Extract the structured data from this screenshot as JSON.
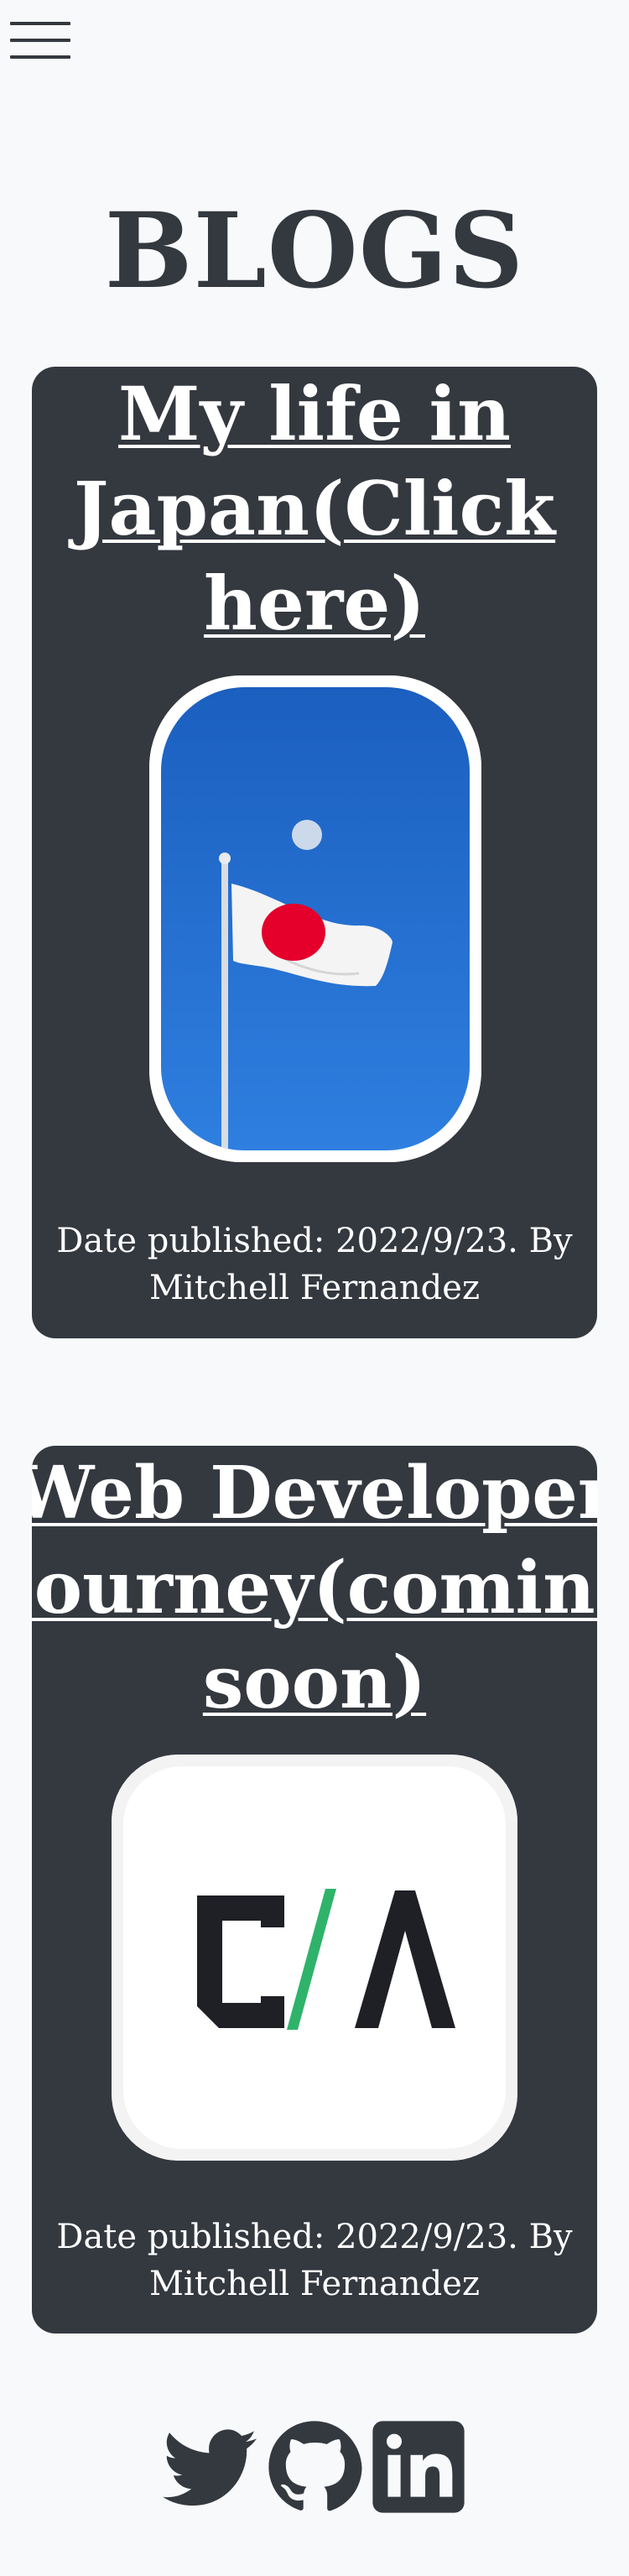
{
  "nav": {
    "menu_icon": "hamburger-menu-icon"
  },
  "page": {
    "title": "BLOGS"
  },
  "blogs": [
    {
      "title_line1": "My life in",
      "title_line2": "Japan(Click",
      "title_line3": "here)",
      "image_alt": "Japanese flag on a flagpole against blue sky with the moon",
      "published_line1": "Date published: 2022/9/23. By",
      "published_line2": "Mitchell Fernandez"
    },
    {
      "title_line1": "Web Developer",
      "title_line2": "Journey(coming",
      "title_line3": "soon)",
      "image_alt": "C/A logo",
      "published_line1": "Date published: 2022/9/23. By",
      "published_line2": "Mitchell Fernandez"
    }
  ],
  "socials": [
    {
      "icon": "twitter-icon"
    },
    {
      "icon": "github-icon"
    },
    {
      "icon": "linkedin-icon"
    }
  ],
  "colors": {
    "background": "#f8f9fb",
    "card": "#34383f",
    "text_dark": "#34383f",
    "text_light": "#ffffff",
    "flag_sky": "#1a64c8",
    "flag_red": "#e4002b",
    "logo_green": "#2fb36b"
  }
}
